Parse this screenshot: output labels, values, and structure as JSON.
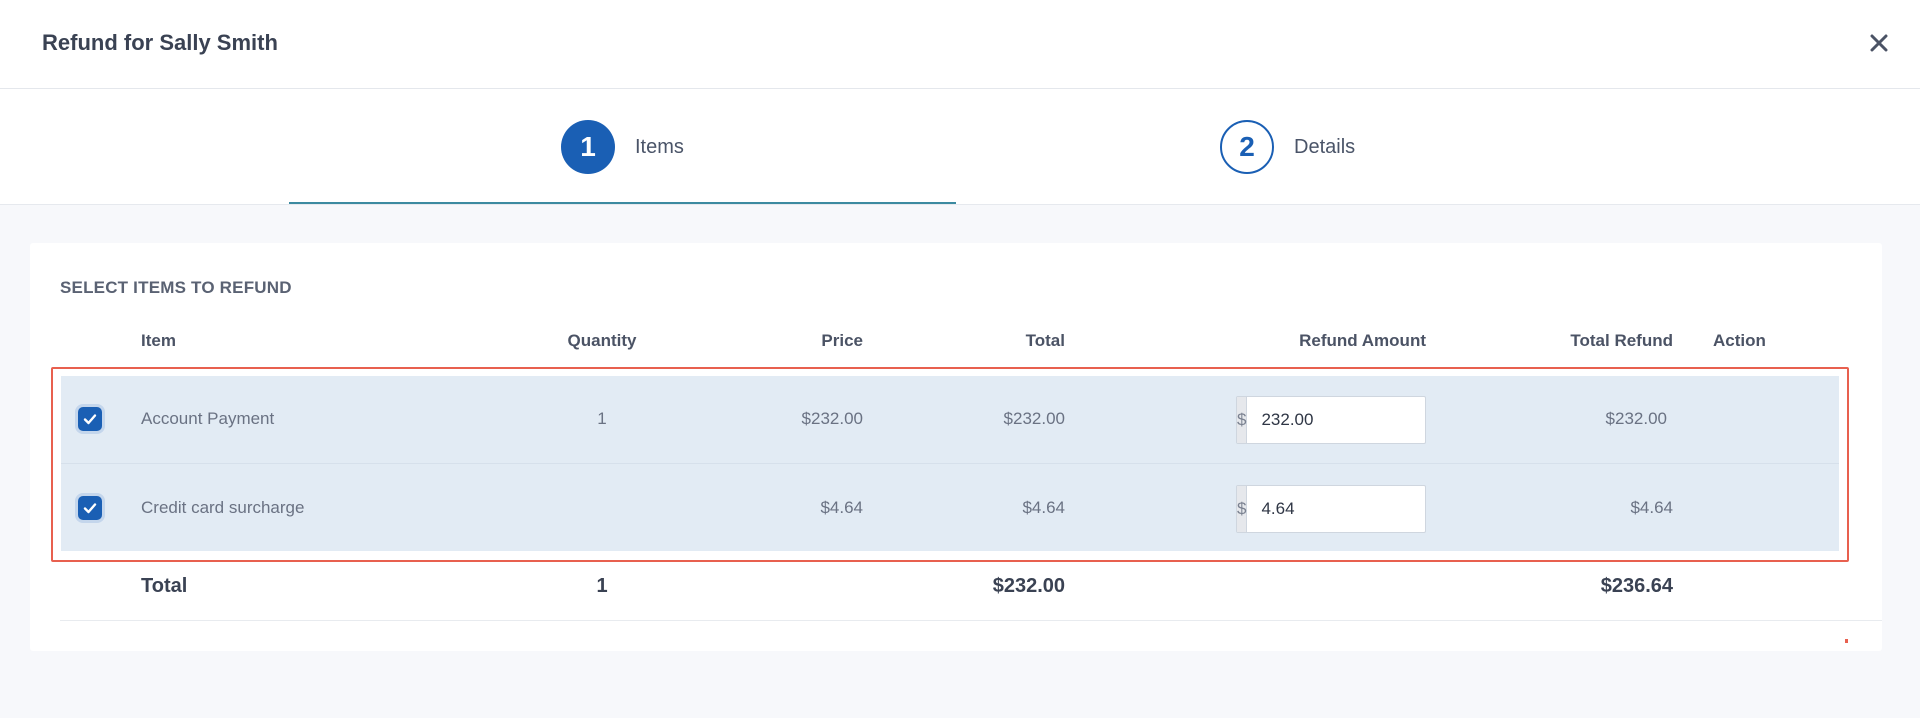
{
  "header": {
    "title": "Refund for Sally Smith"
  },
  "steps": [
    {
      "number": "1",
      "label": "Items"
    },
    {
      "number": "2",
      "label": "Details"
    }
  ],
  "section": {
    "title": "SELECT ITEMS TO REFUND"
  },
  "table": {
    "columns": {
      "item": "Item",
      "quantity": "Quantity",
      "price": "Price",
      "total": "Total",
      "refund_amount": "Refund Amount",
      "total_refund": "Total Refund",
      "action": "Action"
    },
    "rows": [
      {
        "checked": true,
        "item": "Account Payment",
        "quantity": "1",
        "price": "$232.00",
        "total": "$232.00",
        "currency": "$",
        "refund_amount": "232.00",
        "total_refund": "$232.00"
      },
      {
        "checked": true,
        "item": "Credit card surcharge",
        "quantity": "",
        "price": "$4.64",
        "total": "$4.64",
        "currency": "$",
        "refund_amount": "4.64",
        "total_refund": "$4.64"
      }
    ],
    "totals": {
      "label": "Total",
      "quantity": "1",
      "total": "$232.00",
      "total_refund": "$236.64"
    }
  },
  "colors": {
    "primary": "#1a5fb4",
    "highlight_border": "#e8604f",
    "row_background": "#e2ebf4",
    "step_underline": "#3c8aa0"
  },
  "icons": {
    "close": "close-icon",
    "check": "check-icon"
  }
}
